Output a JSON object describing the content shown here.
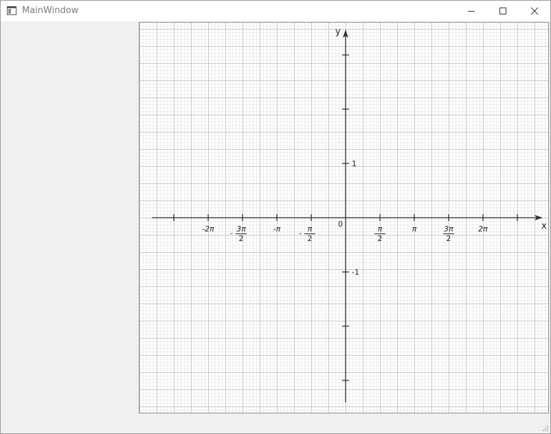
{
  "window": {
    "title": "MainWindow",
    "icon": "app-window-icon",
    "buttons": {
      "minimize": "minimize-icon",
      "maximize": "maximize-icon",
      "close": "close-icon"
    }
  },
  "colors": {
    "grid_minor": "#dcdcdc",
    "grid_major": "#b8b8b8",
    "axis": "#333333",
    "client_bg": "#f0f0f0"
  },
  "chart_data": {
    "type": "line",
    "series": [],
    "xlabel": "x",
    "ylabel": "y",
    "origin_label": "0",
    "grid": true,
    "xlim": [
      -7.85,
      9.03
    ],
    "ylim": [
      -1.72,
      1.72
    ],
    "x_ticks": [
      {
        "value": -7.854,
        "label": ""
      },
      {
        "value": -6.283,
        "label": "-2π"
      },
      {
        "value": -4.712,
        "label": "-3π/2"
      },
      {
        "value": -3.142,
        "label": "-π"
      },
      {
        "value": -1.571,
        "label": "-π/2"
      },
      {
        "value": 1.571,
        "label": "π/2"
      },
      {
        "value": 3.142,
        "label": "π"
      },
      {
        "value": 4.712,
        "label": "3π/2"
      },
      {
        "value": 6.283,
        "label": "2π"
      },
      {
        "value": 7.854,
        "label": ""
      }
    ],
    "y_ticks": [
      {
        "value": 1.5,
        "label": ""
      },
      {
        "value": 1.0,
        "label": ""
      },
      {
        "value": 0.5,
        "label": "1"
      },
      {
        "value": -0.5,
        "label": "-1"
      },
      {
        "value": -1.0,
        "label": ""
      },
      {
        "value": -1.5,
        "label": ""
      }
    ]
  }
}
